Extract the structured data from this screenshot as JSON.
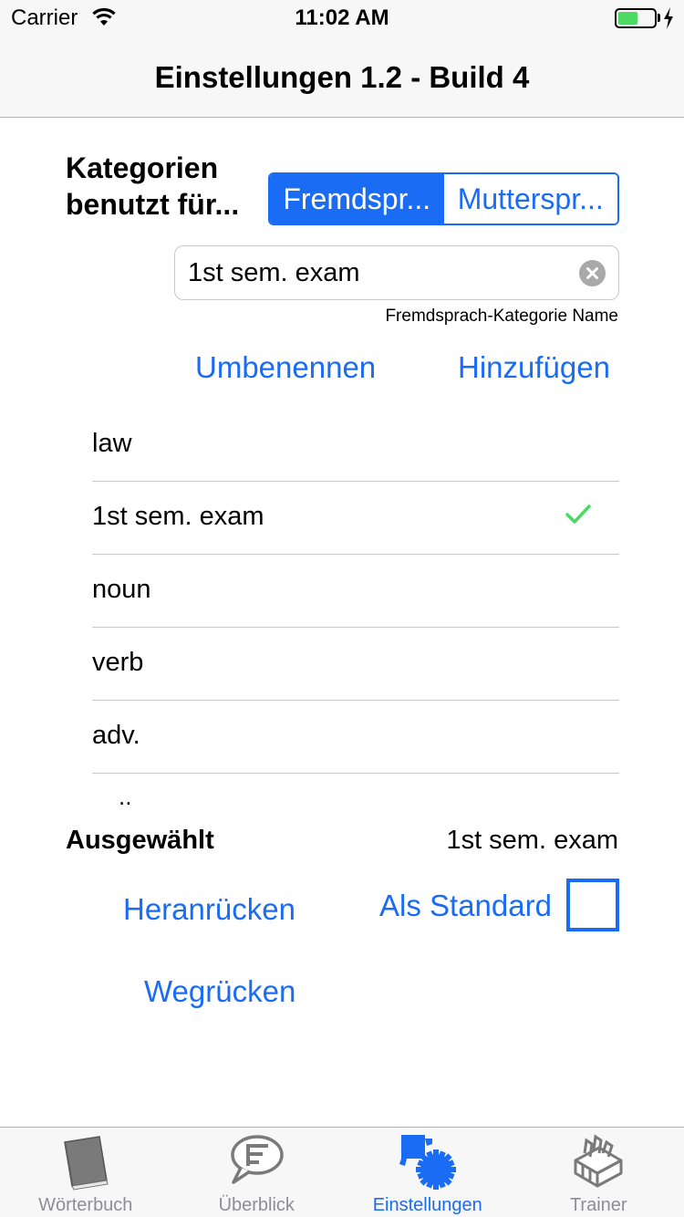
{
  "status_bar": {
    "carrier": "Carrier",
    "time": "11:02 AM"
  },
  "nav": {
    "title": "Einstellungen 1.2 - Build 4"
  },
  "categories": {
    "label": "Kategorien benutzt für...",
    "segments": [
      {
        "label": "Fremdspr...",
        "selected": true
      },
      {
        "label": "Mutterspr...",
        "selected": false
      }
    ],
    "name_value": "1st sem. exam",
    "name_caption": "Fremdsprach-Kategorie Name",
    "rename_label": "Umbenennen",
    "add_label": "Hinzufügen",
    "items": [
      {
        "label": "law",
        "checked": false
      },
      {
        "label": "1st sem. exam",
        "checked": true
      },
      {
        "label": "noun",
        "checked": false
      },
      {
        "label": "verb",
        "checked": false
      },
      {
        "label": "adv.",
        "checked": false
      }
    ],
    "more_indicator": ".."
  },
  "selected": {
    "label": "Ausgewählt",
    "value": "1st sem. exam",
    "move_up_label": "Heranrücken",
    "move_down_label": "Wegrücken",
    "default_label": "Als Standard",
    "default_checked": false
  },
  "tabs": [
    {
      "label": "Wörterbuch",
      "icon": "book-icon",
      "active": false
    },
    {
      "label": "Überblick",
      "icon": "speech-bubble-icon",
      "active": false
    },
    {
      "label": "Einstellungen",
      "icon": "gears-icon",
      "active": true
    },
    {
      "label": "Trainer",
      "icon": "card-boxes-icon",
      "active": false
    }
  ],
  "colors": {
    "accent": "#1a6cf5",
    "check": "#4cd964",
    "battery": "#4cd964"
  }
}
